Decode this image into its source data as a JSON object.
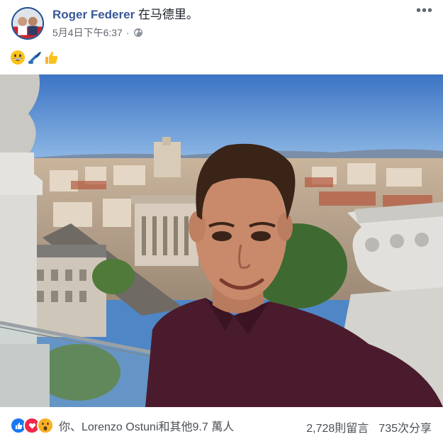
{
  "post": {
    "author_name": "Roger Federer",
    "location_text": "在马德里。",
    "timestamp": "5月4日下午6:37",
    "separator": "·",
    "privacy_icon": "globe-icon",
    "more_label": "•••",
    "emojis": [
      "grinning-face-emoji",
      "tennis-racket-emoji",
      "thumbs-up-emoji"
    ]
  },
  "photo": {
    "alt_subject": "selfie-madrid-rooftop"
  },
  "footer": {
    "reaction_icons": [
      "like-icon",
      "love-icon",
      "wow-icon"
    ],
    "reaction_summary": "你、Lorenzo Ostuni和其他9.7 萬人",
    "comments": "2,728則留言",
    "shares": "735次分享"
  },
  "colors": {
    "link_blue": "#385898",
    "meta_gray": "#616770",
    "like_blue": "#1877f2",
    "love_red": "#f0284a",
    "wow_yellow": "#f7b125"
  }
}
